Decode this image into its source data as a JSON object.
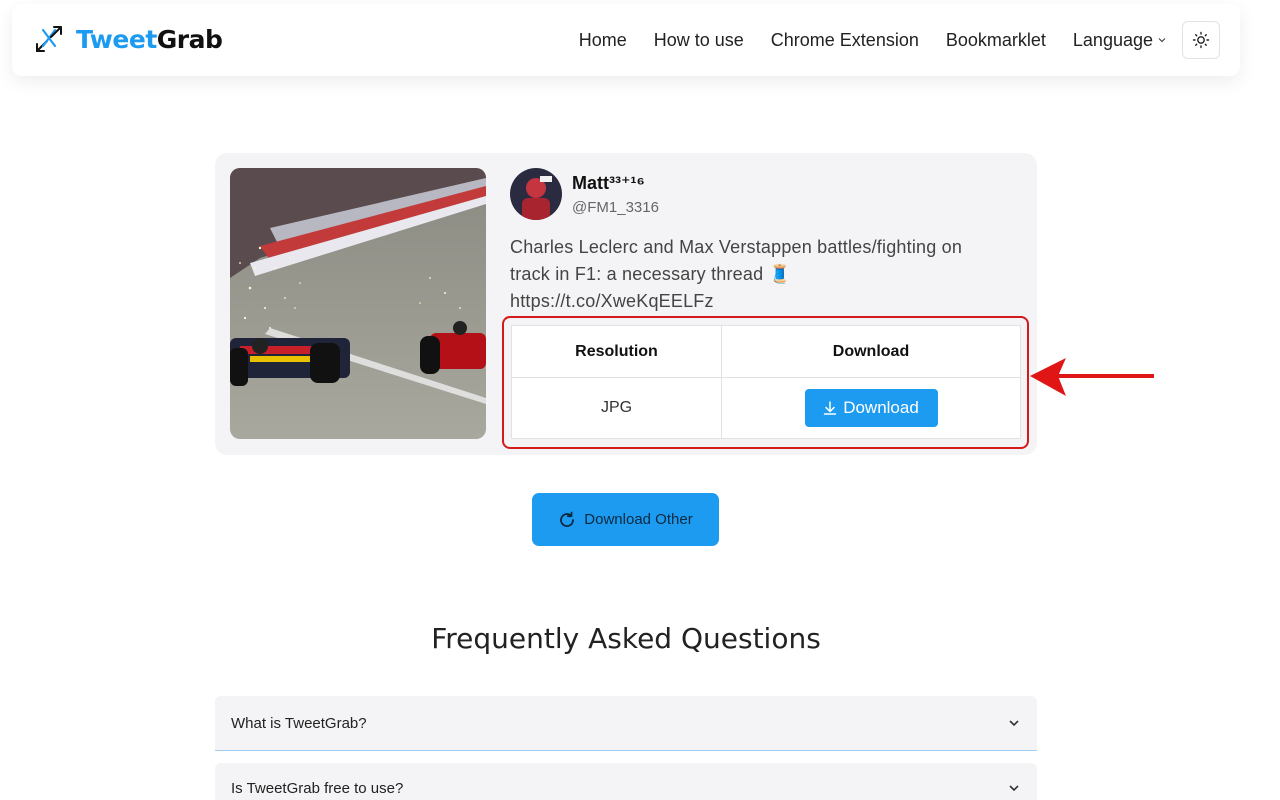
{
  "header": {
    "brand_part1": "Tweet",
    "brand_part2": "Grab",
    "nav": {
      "home": "Home",
      "how_to_use": "How to use",
      "chrome_extension": "Chrome Extension",
      "bookmarklet": "Bookmarklet",
      "language": "Language"
    }
  },
  "tweet": {
    "user_name": "Matt³³⁺¹⁶",
    "user_handle": "@FM1_3316",
    "text_line1": "Charles Leclerc and Max Verstappen battles/fighting on",
    "text_line2": "track in F1: a necessary thread 🧵",
    "text_line3": "https://t.co/XweKqEELFz"
  },
  "download_table": {
    "headers": [
      "Resolution",
      "Download"
    ],
    "rows": [
      {
        "resolution": "JPG",
        "button": "Download"
      }
    ]
  },
  "download_other": "Download Other",
  "faq": {
    "title": "Frequently Asked Questions",
    "items": [
      {
        "question": "What is TweetGrab?"
      },
      {
        "question": "Is TweetGrab free to use?"
      }
    ]
  },
  "colors": {
    "accent": "#1d9bf0",
    "highlight": "#d41a1a",
    "card_bg": "#f4f4f6"
  },
  "icons": [
    "logo-x-icon",
    "chevron-down-icon",
    "sun-icon",
    "download-arrow-icon",
    "refresh-icon",
    "red-arrow-annotation"
  ]
}
